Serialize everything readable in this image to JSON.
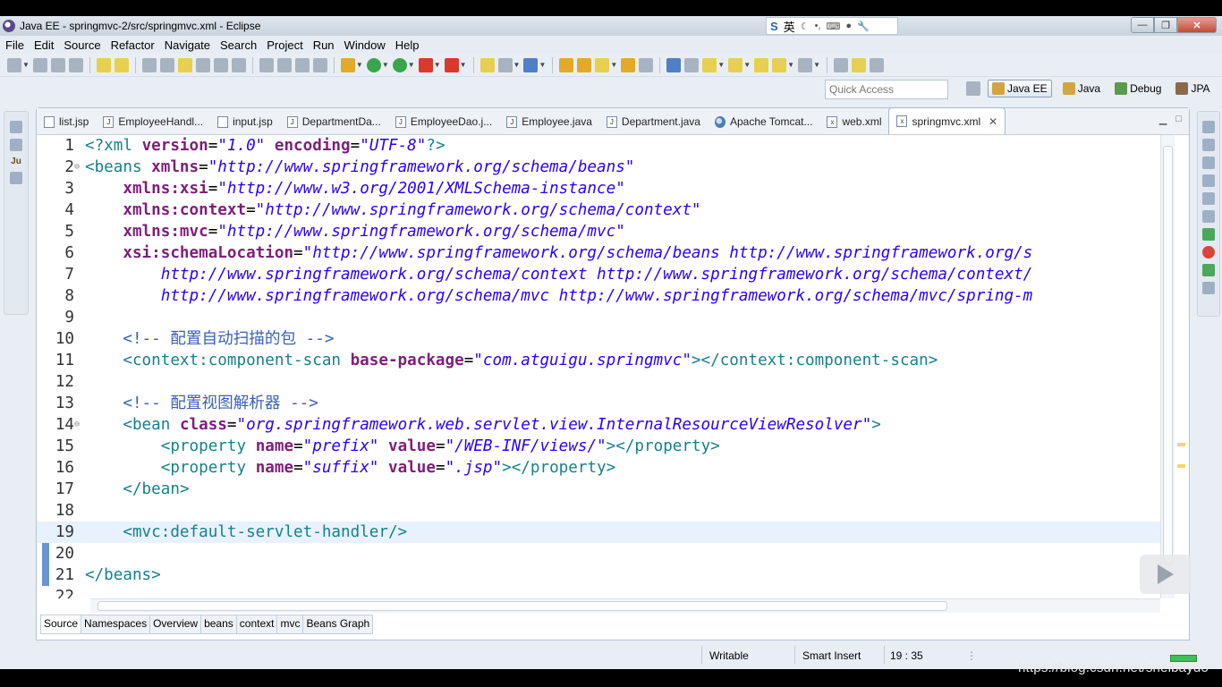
{
  "window": {
    "title": "Java EE - springmvc-2/src/springmvc.xml - Eclipse",
    "ime_label": "英"
  },
  "menu": [
    "File",
    "Edit",
    "Source",
    "Refactor",
    "Navigate",
    "Search",
    "Project",
    "Run",
    "Window",
    "Help"
  ],
  "quick_access": {
    "placeholder": "Quick Access"
  },
  "perspectives": [
    {
      "label": "Java EE",
      "active": true
    },
    {
      "label": "Java",
      "active": false
    },
    {
      "label": "Debug",
      "active": false
    },
    {
      "label": "JPA",
      "active": false
    }
  ],
  "tabs": [
    {
      "label": "list.jsp",
      "icon": "jsp-file-icon"
    },
    {
      "label": "EmployeeHandl...",
      "icon": "java-file-icon"
    },
    {
      "label": "input.jsp",
      "icon": "jsp-file-icon"
    },
    {
      "label": "DepartmentDa...",
      "icon": "java-file-icon"
    },
    {
      "label": "EmployeeDao.j...",
      "icon": "java-file-icon"
    },
    {
      "label": "Employee.java",
      "icon": "java-file-icon"
    },
    {
      "label": "Department.java",
      "icon": "java-file-icon"
    },
    {
      "label": "Apache Tomcat...",
      "icon": "globe-icon"
    },
    {
      "label": "web.xml",
      "icon": "xml-file-icon"
    },
    {
      "label": "springmvc.xml",
      "icon": "xml-file-icon",
      "active": true
    }
  ],
  "editor": {
    "current_line": 19,
    "lines": [
      {
        "n": "1",
        "text": "<?xml version=\"1.0\" encoding=\"UTF-8\"?>"
      },
      {
        "n": "2",
        "text": "<beans xmlns=\"http://www.springframework.org/schema/beans\""
      },
      {
        "n": "3",
        "text": "    xmlns:xsi=\"http://www.w3.org/2001/XMLSchema-instance\""
      },
      {
        "n": "4",
        "text": "    xmlns:context=\"http://www.springframework.org/schema/context\""
      },
      {
        "n": "5",
        "text": "    xmlns:mvc=\"http://www.springframework.org/schema/mvc\""
      },
      {
        "n": "6",
        "text": "    xsi:schemaLocation=\"http://www.springframework.org/schema/beans http://www.springframework.org/s"
      },
      {
        "n": "7",
        "text": "        http://www.springframework.org/schema/context http://www.springframework.org/schema/context/"
      },
      {
        "n": "8",
        "text": "        http://www.springframework.org/schema/mvc http://www.springframework.org/schema/mvc/spring-m"
      },
      {
        "n": "9",
        "text": ""
      },
      {
        "n": "10",
        "text": "    <!-- 配置自动扫描的包 -->"
      },
      {
        "n": "11",
        "text": "    <context:component-scan base-package=\"com.atguigu.springmvc\"></context:component-scan>"
      },
      {
        "n": "12",
        "text": ""
      },
      {
        "n": "13",
        "text": "    <!-- 配置视图解析器 -->"
      },
      {
        "n": "14",
        "text": "    <bean class=\"org.springframework.web.servlet.view.InternalResourceViewResolver\">"
      },
      {
        "n": "15",
        "text": "        <property name=\"prefix\" value=\"/WEB-INF/views/\"></property>"
      },
      {
        "n": "16",
        "text": "        <property name=\"suffix\" value=\".jsp\"></property>"
      },
      {
        "n": "17",
        "text": "    </bean>"
      },
      {
        "n": "18",
        "text": ""
      },
      {
        "n": "19",
        "text": "    <mvc:default-servlet-handler/>"
      },
      {
        "n": "20",
        "text": ""
      },
      {
        "n": "21",
        "text": "</beans>"
      },
      {
        "n": "22",
        "text": ""
      }
    ]
  },
  "bottom_tabs": [
    "Source",
    "Namespaces",
    "Overview",
    "beans",
    "context",
    "mvc",
    "Beans Graph"
  ],
  "status": {
    "mode": "Writable",
    "insert": "Smart Insert",
    "position": "19 : 35"
  },
  "watermark": "https://blog.csdn.net/shelbaydo",
  "colors": {
    "tag": "#17808a",
    "attr": "#7f1e7a",
    "string": "#2a00ff",
    "comment": "#3a5fb8"
  }
}
